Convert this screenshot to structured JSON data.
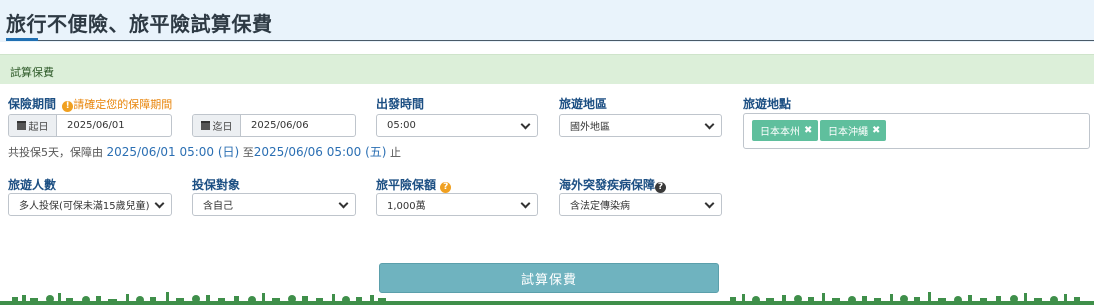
{
  "page": {
    "title": "旅行不便險、旅平險試算保費"
  },
  "section": {
    "title": "試算保費"
  },
  "period": {
    "label": "保險期間",
    "warning": "請確定您的保障期間",
    "start": {
      "addon": "起日",
      "value": "2025/06/01"
    },
    "end": {
      "addon": "迄日",
      "value": "2025/06/06"
    },
    "summary_prefix": "共投保5天，保障由 ",
    "summary_start": "2025/06/01 05:00 (日)",
    "summary_mid": " 至",
    "summary_end": "2025/06/06 05:00 (五)",
    "summary_suffix": " 止"
  },
  "departure": {
    "label": "出發時間",
    "value": "05:00"
  },
  "region": {
    "label": "旅遊地區",
    "value": "國外地區"
  },
  "destination": {
    "label": "旅遊地點",
    "tags": [
      "日本本州",
      "日本沖繩"
    ]
  },
  "travelers": {
    "label": "旅遊人數",
    "value": "多人投保(可保未滿15歲兒童)"
  },
  "insured": {
    "label": "投保對象",
    "value": "含自己"
  },
  "coverage": {
    "label": "旅平險保額",
    "value": "1,000萬"
  },
  "illness": {
    "label": "海外突發疾病保障",
    "value": "含法定傳染病"
  },
  "submit": {
    "label": "試算保費"
  },
  "colors": {
    "accent": "#1f6fb2",
    "tag": "#5fbf9d",
    "button": "#6fb3bf",
    "section": "#dcefd9",
    "warning": "#e8860c"
  }
}
